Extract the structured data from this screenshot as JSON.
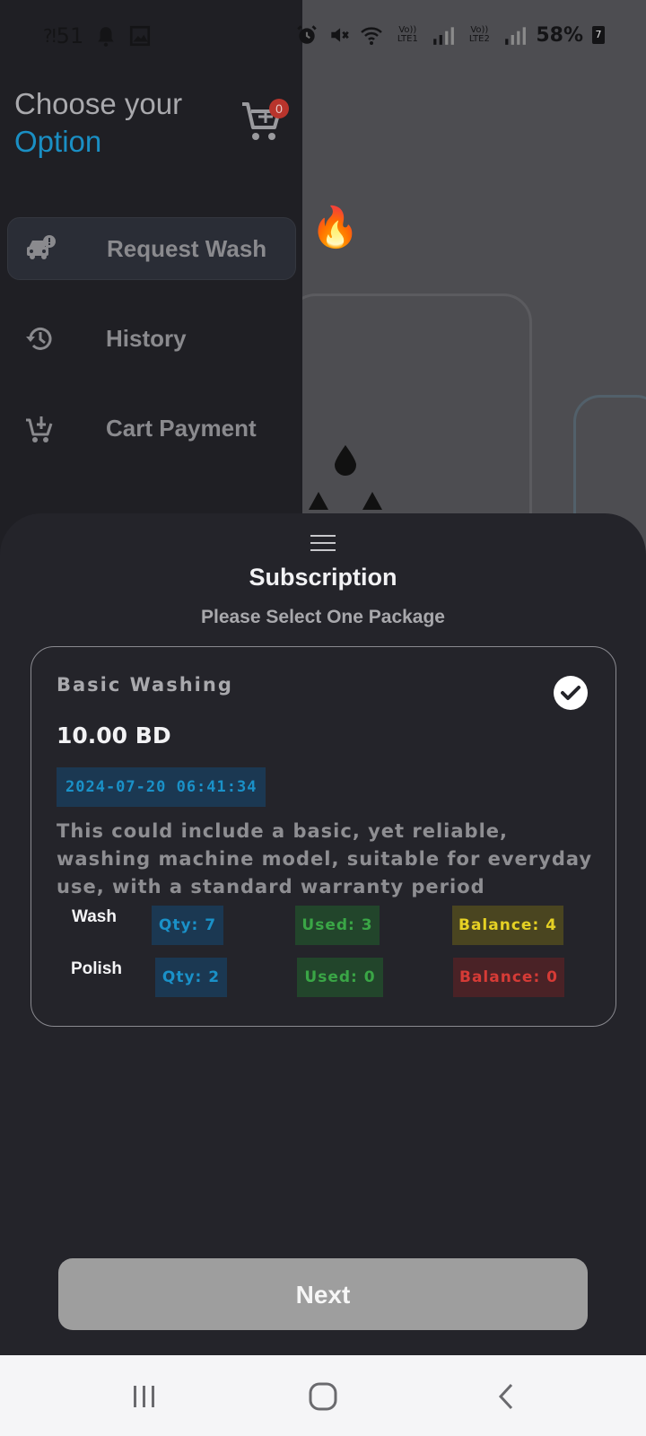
{
  "status_bar": {
    "left_text": "51",
    "battery": "58%",
    "battery_badge": "7",
    "sim1": "Vo)) LTE1",
    "sim2": "Vo)) LTE2",
    "icons": [
      "signal-alt-icon",
      "notification-bell-icon",
      "gallery-icon",
      "alarm-icon",
      "mute-icon",
      "wifi-icon",
      "signal-icon",
      "battery-icon"
    ]
  },
  "drawer": {
    "title_line1": "Choose your",
    "title_line2": "Option",
    "cart_count": "0",
    "items": [
      {
        "label": "Request Wash",
        "icon": "car-alert-icon",
        "active": true
      },
      {
        "label": "History",
        "icon": "history-icon",
        "active": false
      },
      {
        "label": "Cart Payment",
        "icon": "cart-plus-icon",
        "active": false
      }
    ]
  },
  "sheet": {
    "title": "Subscription",
    "subtitle": "Please Select One Package",
    "package": {
      "name": "Basic Washing",
      "price": "10.00 BD",
      "date": "2024-07-20 06:41:34",
      "selected": true,
      "description": "This could include a basic, yet reliable, washing machine model, suitable for everyday use, with a standard warranty period",
      "usage": [
        {
          "service": "Wash",
          "qty": "Qty: 7",
          "used": "Used: 3",
          "balance": "Balance: 4"
        },
        {
          "service": "Polish",
          "qty": "Qty: 2",
          "used": "Used: 0",
          "balance": "Balance: 0"
        }
      ]
    },
    "next_label": "Next"
  },
  "nav": {
    "buttons": [
      "recent-apps-icon",
      "home-icon",
      "back-icon"
    ]
  },
  "colors": {
    "accent": "#1a8fc4",
    "sheet_bg": "#24242a",
    "drawer_bg": "#1f1f24",
    "used_green": "#3aa646",
    "balance_yellow": "#e6d124",
    "balance_red": "#d63b36"
  }
}
